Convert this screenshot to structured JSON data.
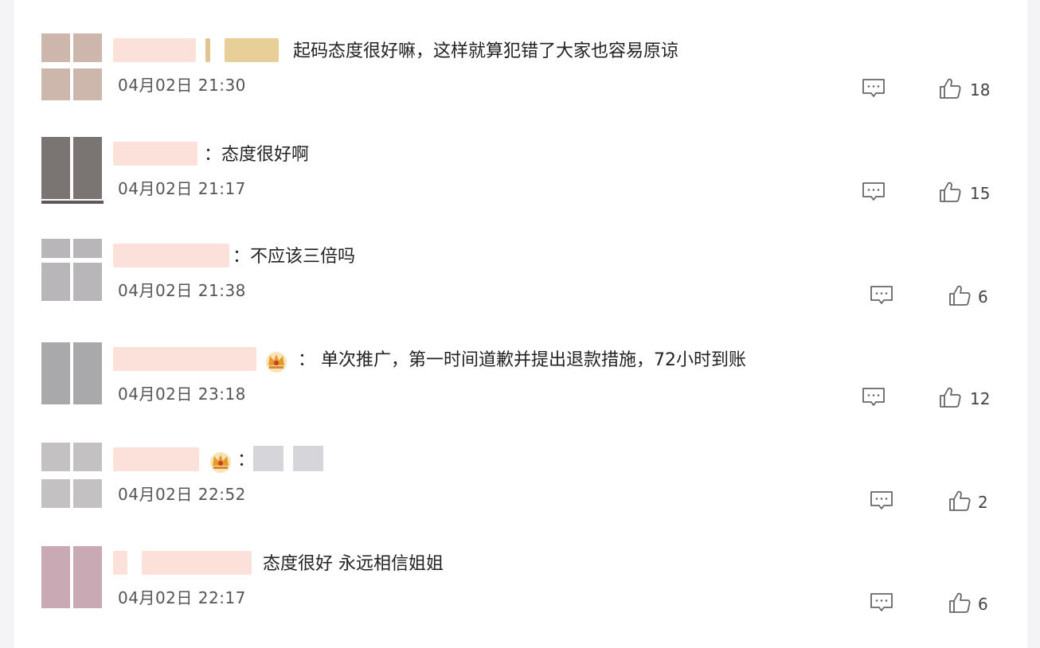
{
  "comments": [
    {
      "text": "起码态度很好嘛，这样就算犯错了大家也容易原谅",
      "time": "04月02日 21:30",
      "likes": "18",
      "avatar_color": "#cdb7ad",
      "name_color": "#f9d8cf"
    },
    {
      "text": "：态度很好啊",
      "time": "04月02日 21:17",
      "likes": "15",
      "avatar_color": "#6f6a69",
      "name_color": "#f9d8cf"
    },
    {
      "text": "：不应该三倍吗",
      "time": "04月02日 21:38",
      "likes": "6",
      "avatar_color": "#b9b6b9",
      "name_color": "#f9d8cf"
    },
    {
      "text": "：  单次推广，第一时间道歉并提出退款措施，72小时到账",
      "time": "04月02日 23:18",
      "likes": "12",
      "avatar_color": "#a9a9ab",
      "name_color": "#f9d8cf"
    },
    {
      "text": "：",
      "time": "04月02日 22:52",
      "likes": "2",
      "avatar_color": "#c3c1c1",
      "name_color": "#f9d8cf"
    },
    {
      "text": "态度很好  永远相信姐姐",
      "time": "04月02日 22:17",
      "likes": "6",
      "avatar_color": "#c9a9b3",
      "name_color": "#f9d8cf"
    }
  ],
  "icons": {
    "reply": "comment-icon",
    "like": "thumbs-up-icon",
    "badge": "crown-badge-icon"
  }
}
